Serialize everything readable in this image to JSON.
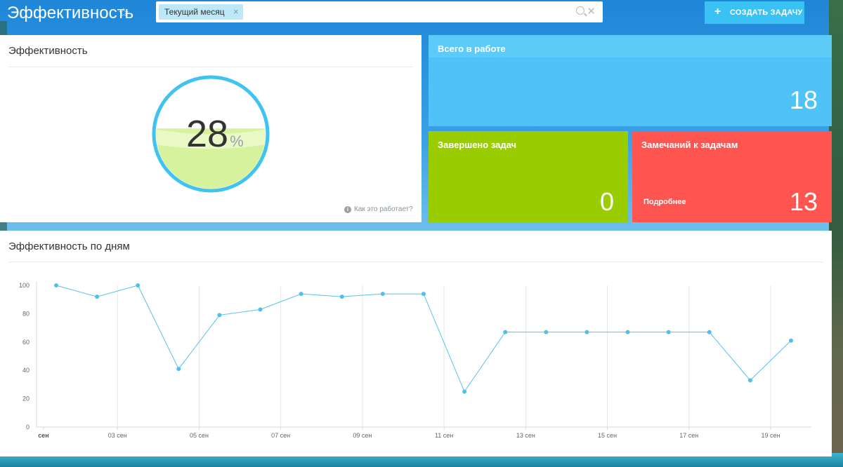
{
  "header": {
    "title": "Эффективность",
    "filter_chip": "Текущий месяц",
    "create_button": "Создать задачу"
  },
  "efficiency": {
    "title": "Эффективность",
    "percent": 28,
    "percent_text": "28",
    "percent_sign": "%",
    "help_link": "Как это работает?"
  },
  "tiles": {
    "in_work": {
      "title": "Всего в работе",
      "value": "18"
    },
    "done": {
      "title": "Завершено задач",
      "value": "0"
    },
    "remarks": {
      "title": "Замечаний к задачам",
      "value": "13",
      "more": "Подробнее"
    }
  },
  "daily": {
    "title": "Эффективность по дням"
  },
  "colors": {
    "accent": "#39c2f3",
    "in_work": "#4fc3f7",
    "done": "#9acd00",
    "remarks": "#fe5551",
    "line": "#59c1ea"
  },
  "chart_data": {
    "type": "line",
    "title": "Эффективность по дням",
    "ylim": [
      0,
      100
    ],
    "yticks": [
      0,
      20,
      40,
      60,
      80,
      100
    ],
    "x_tick_labels": [
      "сен",
      "03 сен",
      "05 сен",
      "07 сен",
      "09 сен",
      "11 сен",
      "13 сен",
      "15 сен",
      "17 сен",
      "19 сен"
    ],
    "x": [
      "01 сен",
      "02 сен",
      "03 сен",
      "04 сен",
      "05 сен",
      "06 сен",
      "07 сен",
      "08 сен",
      "09 сен",
      "10 сен",
      "11 сен",
      "12 сен",
      "13 сен",
      "14 сен",
      "15 сен",
      "16 сен",
      "17 сен",
      "18 сен",
      "19 сен"
    ],
    "values": [
      100,
      92,
      100,
      41,
      79,
      83,
      94,
      92,
      94,
      94,
      25,
      67,
      67,
      67,
      67,
      67,
      67,
      33,
      61
    ],
    "grid": "vertical"
  }
}
